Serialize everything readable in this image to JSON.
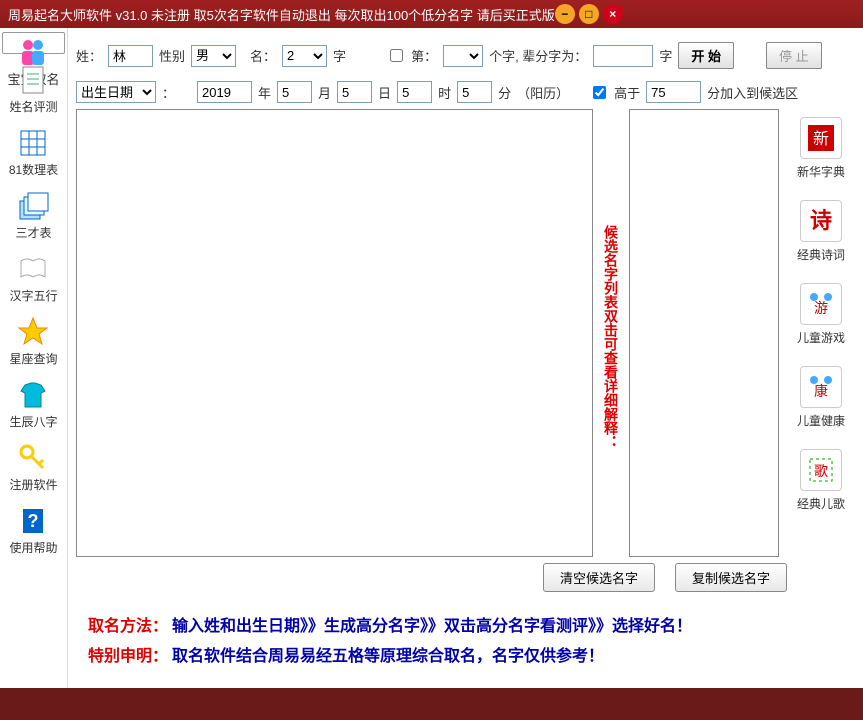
{
  "title": "周易起名大师软件 v31.0    未注册    取5次名字软件自动退出 每次取出100个低分名字 请后买正式版",
  "sidebar": [
    {
      "label": "宝宝取名"
    },
    {
      "label": "姓名评测"
    },
    {
      "label": "81数理表"
    },
    {
      "label": "三才表"
    },
    {
      "label": "汉字五行"
    },
    {
      "label": "星座查询"
    },
    {
      "label": "生辰八字"
    },
    {
      "label": "注册软件"
    },
    {
      "label": "使用帮助"
    }
  ],
  "form": {
    "surname_lbl": "姓：",
    "surname_val": "林",
    "gender_lbl": "性别",
    "gender_val": "男",
    "name_lbl": "名：",
    "chars_val": "2",
    "chars_unit": "字",
    "nth_lbl": "第：",
    "nth_unit": "个字, 辈分字为：",
    "gen_unit": "字",
    "start_btn": "开    始",
    "stop_btn": "停    止",
    "birth_lbl": "出生日期",
    "year": "2019",
    "year_u": "年",
    "month": "5",
    "month_u": "月",
    "day": "5",
    "day_u": "日",
    "hour": "5",
    "hour_u": "时",
    "minute": "5",
    "minute_u": "分",
    "cal": "（阳历）",
    "gt_lbl": "高于",
    "gt_val": "75",
    "gt_suffix": "分加入到候选区"
  },
  "vtext": "候选名字列表双击可查看详细解释：",
  "right": [
    {
      "label": "新华字典"
    },
    {
      "label": "经典诗词"
    },
    {
      "label": "儿童游戏"
    },
    {
      "label": "儿童健康"
    },
    {
      "label": "经典儿歌"
    }
  ],
  "bottom": {
    "clear": "清空候选名字",
    "copy": "复制候选名字"
  },
  "footer": {
    "line1_lbl": "取名方法：",
    "line1_txt": "输入姓和出生日期》》生成高分名字》》双击高分名字看测评》》选择好名！",
    "line2_lbl": "特别申明：",
    "line2_txt": "取名软件结合周易易经五格等原理综合取名，名字仅供参考！"
  }
}
